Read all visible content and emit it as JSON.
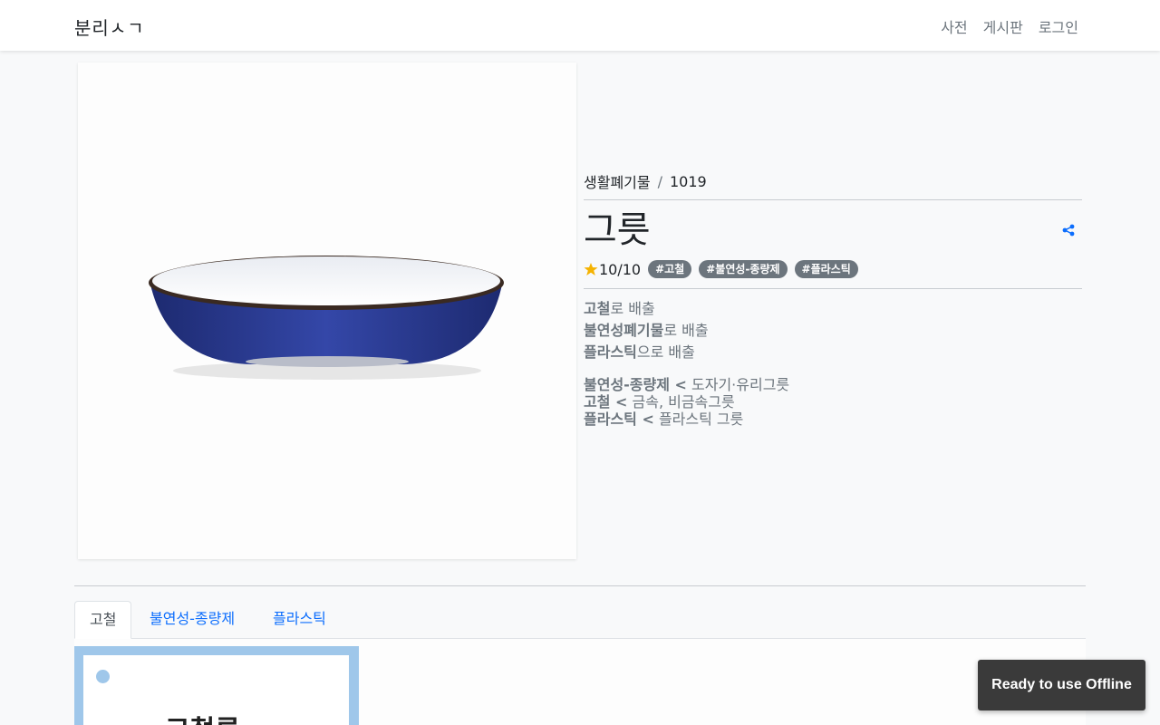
{
  "navbar": {
    "brand": "분리ㅅㄱ",
    "links": [
      "사전",
      "게시판",
      "로그인"
    ]
  },
  "breadcrumb": {
    "category": "생활폐기물",
    "separator": "/",
    "item_id": "1019"
  },
  "item": {
    "title": "그릇",
    "rating": "10/10",
    "tags": [
      "#고철",
      "#불연성-종량제",
      "#플라스틱"
    ]
  },
  "disposal": [
    {
      "bold": "고철",
      "rest": "로 배출"
    },
    {
      "bold": "불연성폐기물",
      "rest": "로 배출"
    },
    {
      "bold": "플라스틱",
      "rest": "으로 배출"
    }
  ],
  "rules": [
    {
      "bold": "불연성-종량제 <",
      "rest": " 도자기·유리그릇"
    },
    {
      "bold": "고철 <",
      "rest": " 금속, 비금속그릇"
    },
    {
      "bold": "플라스틱 <",
      "rest": " 플라스틱 그릇"
    }
  ],
  "tabs": [
    "고철",
    "불연성-종량제",
    "플라스틱"
  ],
  "active_tab": "고철",
  "poster_text": "고철류",
  "toast": "Ready to use Offline",
  "colors": {
    "accent": "#0d6efd",
    "tag_bg": "#6c757d",
    "bowl_blue": "#2b3a8f",
    "star": "#f5b301",
    "poster_blue": "#9fc7ea"
  },
  "icons": {
    "share": "share-icon",
    "star": "star-icon"
  }
}
